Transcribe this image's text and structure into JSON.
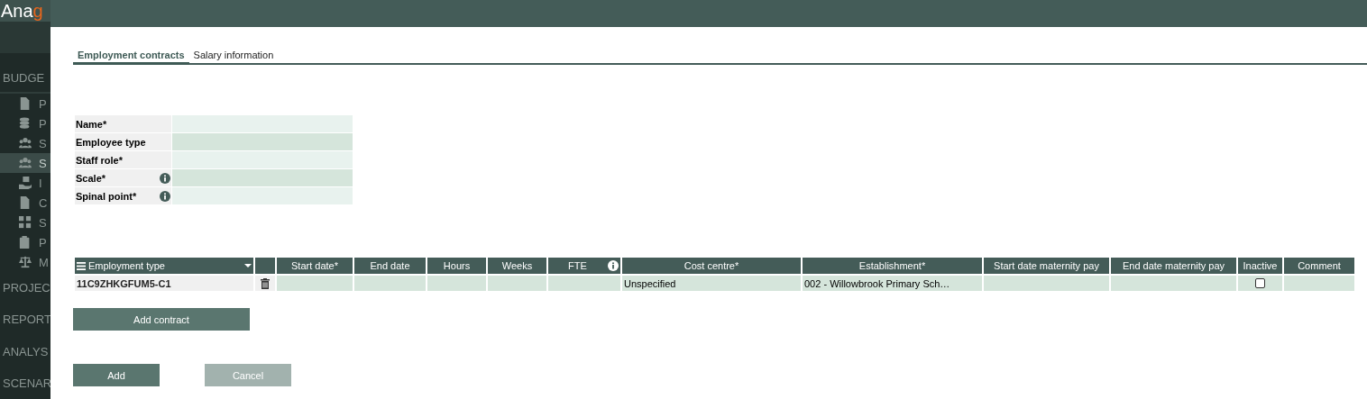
{
  "sidebar": {
    "logo": {
      "text": "Ana",
      "accent": "g"
    },
    "section": "BUDGE",
    "items": [
      {
        "kind": "file",
        "label": "P",
        "selected": false
      },
      {
        "kind": "coins",
        "label": "P",
        "selected": false
      },
      {
        "kind": "users",
        "label": "S",
        "selected": false
      },
      {
        "kind": "users",
        "label": "S",
        "selected": true
      },
      {
        "kind": "hand",
        "label": "I",
        "selected": false
      },
      {
        "kind": "file",
        "label": "C",
        "selected": false
      },
      {
        "kind": "grid",
        "label": "S",
        "selected": false
      },
      {
        "kind": "clipboard",
        "label": "P",
        "selected": false
      },
      {
        "kind": "scale",
        "label": "M",
        "selected": false
      }
    ],
    "sections": [
      "PROJEC",
      "REPORT",
      "ANALYS",
      "SCENAR"
    ]
  },
  "tabs": [
    {
      "label": "Employment contracts",
      "selected": true
    },
    {
      "label": "Salary information",
      "selected": false
    }
  ],
  "form": [
    {
      "label": "Name*",
      "info": false
    },
    {
      "label": "Employee type",
      "info": false
    },
    {
      "label": "Staff role*",
      "info": false
    },
    {
      "label": "Scale*",
      "info": true
    },
    {
      "label": "Spinal point*",
      "info": true
    }
  ],
  "table": {
    "columns": [
      {
        "label": "Employment type",
        "kind": "menu"
      },
      {
        "kind": "blank"
      },
      {
        "label": "Start date*",
        "kind": "text",
        "info": false
      },
      {
        "label": "End date",
        "kind": "text",
        "info": false
      },
      {
        "label": "Hours",
        "kind": "text",
        "info": false
      },
      {
        "label": "Weeks",
        "kind": "text",
        "info": false
      },
      {
        "label": "FTE",
        "kind": "text",
        "info": true
      },
      {
        "label": "Cost centre*",
        "kind": "text",
        "info": false
      },
      {
        "label": "Establishment*",
        "kind": "text",
        "info": false
      },
      {
        "label": "Start date maternity pay",
        "kind": "text",
        "info": false
      },
      {
        "label": "End date maternity pay",
        "kind": "text",
        "info": false
      },
      {
        "label": "Inactive",
        "kind": "text",
        "info": false
      },
      {
        "label": "Comment",
        "kind": "text",
        "info": false
      }
    ],
    "rows": [
      {
        "cells": [
          {
            "kind": "id",
            "text": "11C9ZHKGFUM5-C1"
          },
          {
            "kind": "delete"
          },
          {
            "kind": "empty"
          },
          {
            "kind": "empty"
          },
          {
            "kind": "empty"
          },
          {
            "kind": "empty"
          },
          {
            "kind": "empty"
          },
          {
            "kind": "text",
            "text": "Unspecified"
          },
          {
            "kind": "text",
            "text": "002 - Willowbrook Primary Sch…"
          },
          {
            "kind": "empty"
          },
          {
            "kind": "empty"
          },
          {
            "kind": "checkbox",
            "checked": false
          },
          {
            "kind": "empty"
          }
        ]
      }
    ]
  },
  "add_contract": "Add contract",
  "actions": [
    {
      "label": "Add",
      "disabled": false
    },
    {
      "label": "Cancel",
      "disabled": true
    }
  ]
}
